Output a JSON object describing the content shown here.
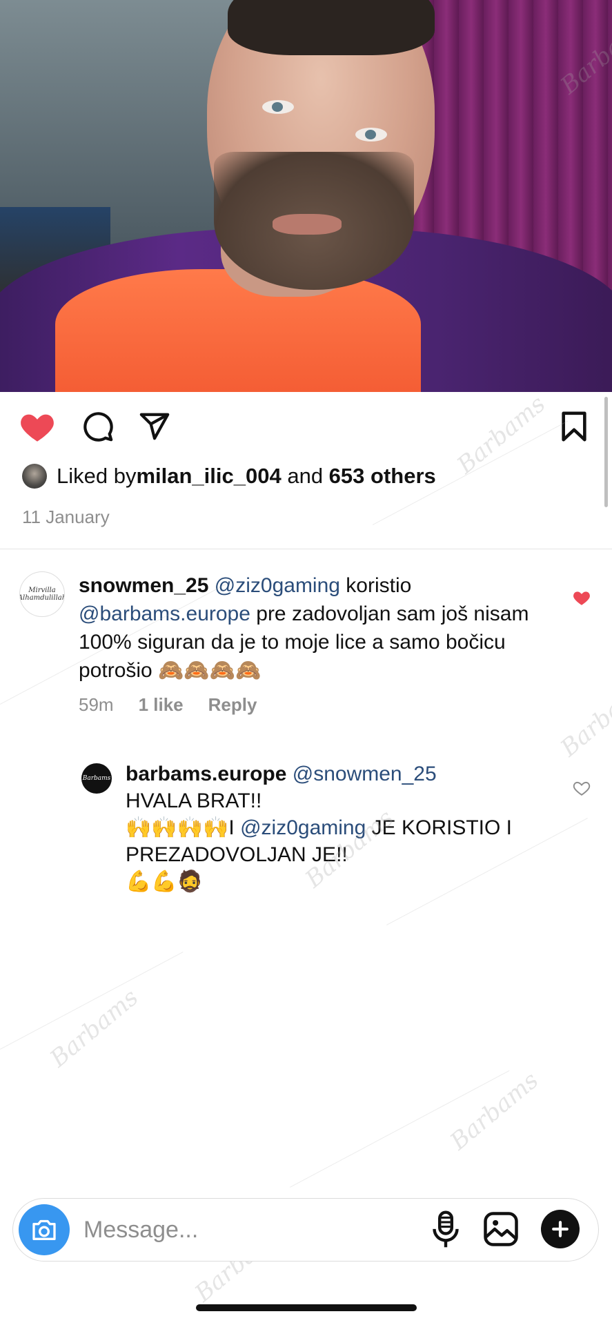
{
  "post": {
    "liked_prefix": "Liked by ",
    "liked_user": "milan_ilic_004",
    "liked_mid": " and ",
    "liked_count": "653 others",
    "date": "11 January"
  },
  "comment": {
    "username": "snowmen_25",
    "mention1": "@ziz0gaming",
    "text1": " koristio ",
    "mention2": "@barbams.europe",
    "text2": " pre zadovoljan sam još nisam 100% siguran da je to moje lice a samo bočicu potrošio 🙈🙈🙈🙈",
    "time": "59m",
    "likes": "1 like",
    "reply_label": "Reply",
    "liked": true,
    "avatar_text": "Mirvilla Alhamdulillah"
  },
  "reply": {
    "username": "barbams.europe",
    "mention1": "@snowmen_25",
    "line1": "HVALA BRAT!!",
    "line2_prefix": "🙌🙌🙌🙌I ",
    "mention2": "@ziz0gaming",
    "line2_suffix": " JE KORISTIO I PREZADOVOLJAN JE!!",
    "line3": "💪💪🧔",
    "avatar_text": "Barbams",
    "liked": false
  },
  "composer": {
    "placeholder": "Message..."
  },
  "watermark": "Barbams",
  "colors": {
    "like_red": "#ed4956",
    "mention_blue": "#2b4d7a",
    "camera_blue": "#3897f0",
    "muted_gray": "#8e8e8e"
  },
  "icons": {
    "like": "heart-icon",
    "comment": "comment-icon",
    "share": "send-icon",
    "save": "bookmark-icon",
    "camera": "camera-icon",
    "mic": "microphone-icon",
    "gallery": "gallery-icon",
    "add": "plus-icon"
  }
}
